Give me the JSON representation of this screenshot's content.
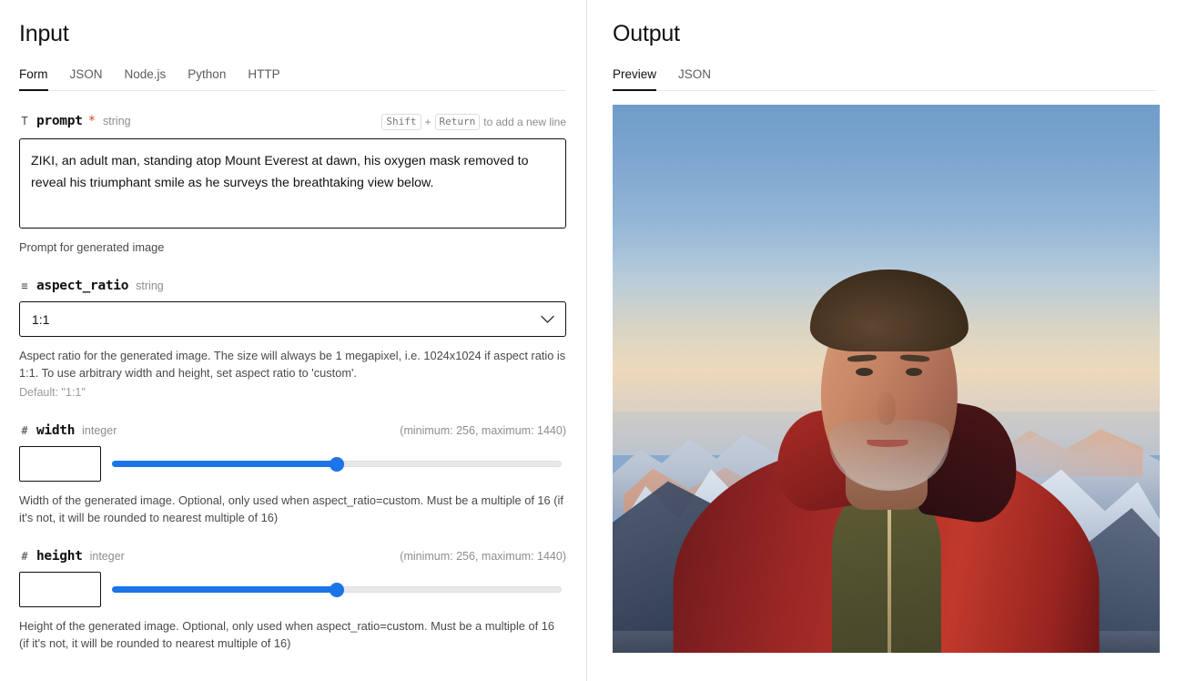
{
  "input_panel": {
    "title": "Input",
    "tabs": [
      {
        "label": "Form",
        "active": true
      },
      {
        "label": "JSON",
        "active": false
      },
      {
        "label": "Node.js",
        "active": false
      },
      {
        "label": "Python",
        "active": false
      },
      {
        "label": "HTTP",
        "active": false
      }
    ],
    "fields": {
      "prompt": {
        "icon": "text-type-icon",
        "icon_glyph": "T",
        "name": "prompt",
        "required_marker": "*",
        "type": "string",
        "hint_key_1": "Shift",
        "hint_plus": "+",
        "hint_key_2": "Return",
        "hint_text": "to add a new line",
        "value": "ZIKI, an adult man, standing atop Mount Everest at dawn, his oxygen mask removed to reveal his triumphant smile as he surveys the breathtaking view below.",
        "description": "Prompt for generated image"
      },
      "aspect_ratio": {
        "icon": "list-enum-icon",
        "icon_glyph": "≡",
        "name": "aspect_ratio",
        "type": "string",
        "value": "1:1",
        "options": [
          "1:1"
        ],
        "description": "Aspect ratio for the generated image. The size will always be 1 megapixel, i.e. 1024x1024 if aspect ratio is 1:1. To use arbitrary width and height, set aspect ratio to 'custom'.",
        "default_text": "Default: \"1:1\""
      },
      "width": {
        "icon": "number-hash-icon",
        "icon_glyph": "#",
        "name": "width",
        "type": "integer",
        "range_note": "(minimum: 256, maximum: 1440)",
        "value": "",
        "slider_percent": 50,
        "minimum": 256,
        "maximum": 1440,
        "description": "Width of the generated image. Optional, only used when aspect_ratio=custom. Must be a multiple of 16 (if it's not, it will be rounded to nearest multiple of 16)"
      },
      "height": {
        "icon": "number-hash-icon",
        "icon_glyph": "#",
        "name": "height",
        "type": "integer",
        "range_note": "(minimum: 256, maximum: 1440)",
        "value": "",
        "slider_percent": 50,
        "minimum": 256,
        "maximum": 1440,
        "description": "Height of the generated image. Optional, only used when aspect_ratio=custom. Must be a multiple of 16 (if it's not, it will be rounded to nearest multiple of 16)"
      }
    }
  },
  "output_panel": {
    "title": "Output",
    "tabs": [
      {
        "label": "Preview",
        "active": true
      },
      {
        "label": "JSON",
        "active": false
      }
    ],
    "preview_image_alt": "Smiling middle-aged man with curly hair in a red jacket standing atop a snowy mountain summit at dawn"
  },
  "colors": {
    "accent_slider": "#1b75e8",
    "required_star": "#d6431f",
    "text_primary": "#111111",
    "text_muted": "#8d8d8d",
    "border": "#e3e3e3"
  }
}
